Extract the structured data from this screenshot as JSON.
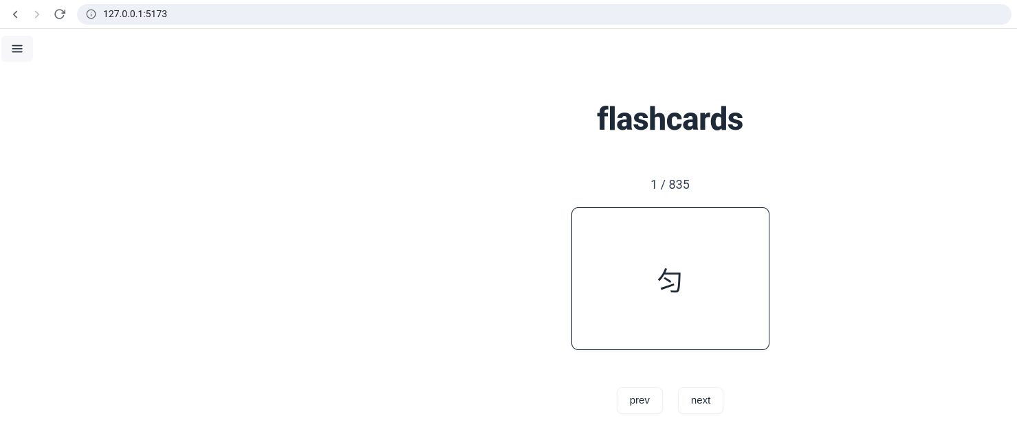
{
  "browser": {
    "url": "127.0.0.1:5173"
  },
  "app": {
    "title": "flashcards",
    "counter": {
      "current": 1,
      "total": 835,
      "display": "1 / 835"
    },
    "card": {
      "front": "匀"
    },
    "buttons": {
      "prev": "prev",
      "next": "next"
    }
  }
}
